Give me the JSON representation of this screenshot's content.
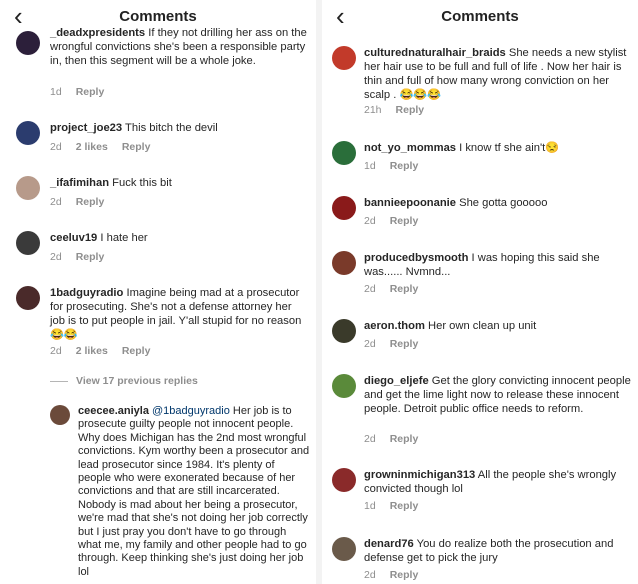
{
  "left": {
    "title": "Comments",
    "comments": [
      {
        "user": "_deadxpresidents",
        "text": "If they not drilling her ass on the wrongful convictions she's been a responsible party in, then this segment will be a whole joke.",
        "time": "1d",
        "reply": "Reply",
        "avatar_color": "#2c1f3a"
      },
      {
        "user": "project_joe23",
        "text": "This bitch the devil",
        "time": "2d",
        "likes": "2 likes",
        "reply": "Reply",
        "avatar_color": "#2b3c6e"
      },
      {
        "user": "_ifafimihan",
        "text": "Fuck this bit",
        "time": "2d",
        "reply": "Reply",
        "avatar_color": "#b79a8a"
      },
      {
        "user": "ceeluv19",
        "text": "I hate her",
        "time": "2d",
        "reply": "Reply",
        "avatar_color": "#3a3a3a"
      },
      {
        "user": "1badguyradio",
        "text": "Imagine being mad at a prosecutor for prosecuting. She's not a defense attorney her job is to put people in jail. Y'all stupid for no reason 😂😂",
        "time": "2d",
        "likes": "2 likes",
        "reply": "Reply",
        "avatar_color": "#4a2a2a"
      }
    ],
    "view_replies": "View 17 previous replies",
    "reply_comment": {
      "user": "ceecee.aniyla",
      "mention": "@1badguyradio",
      "text": "Her job is to prosecute guilty people not innocent people. Why does Michigan has the 2nd most wrongful convictions. Kym worthy been a prosecutor and lead prosecutor since 1984. It's plenty of people who were exonerated because of her convictions and that are still incarcerated. Nobody is mad about her being a prosecutor, we're mad that she's not doing her job correctly but I just pray you don't have to go through what me, my family and other people had to go through. Keep thinking she's just doing her job lol",
      "avatar_color": "#6b4a3a"
    }
  },
  "right": {
    "title": "Comments",
    "comments": [
      {
        "user": "culturednaturalhair_braids",
        "text": "She needs a new stylist her hair use to be full and full of life . Now her hair is thin and full of how many wrong conviction on her scalp . 😂😂😂",
        "time": "21h",
        "reply": "Reply",
        "avatar_color": "#c23a2a"
      },
      {
        "user": "not_yo_mommas",
        "text": "I know tf she ain't😒",
        "time": "1d",
        "reply": "Reply",
        "avatar_color": "#2a6e3a"
      },
      {
        "user": "bannieepoonanie",
        "text": "She gotta gooooo",
        "time": "2d",
        "reply": "Reply",
        "avatar_color": "#8a1a1a"
      },
      {
        "user": "producedbysmooth",
        "text": "I was hoping this said she was...... Nvmnd...",
        "time": "2d",
        "reply": "Reply",
        "avatar_color": "#7a3a2a"
      },
      {
        "user": "aeron.thom",
        "text": "Her own clean up unit",
        "time": "2d",
        "reply": "Reply",
        "avatar_color": "#3a3a2a"
      },
      {
        "user": "diego_eljefe",
        "text": "Get the glory convicting innocent people and get the lime light now to release these innocent people. Detroit public office needs to reform.",
        "time": "2d",
        "reply": "Reply",
        "avatar_color": "#5a8a3a"
      },
      {
        "user": "growninmichigan313",
        "text": "All the people she's wrongly convicted though lol",
        "time": "1d",
        "reply": "Reply",
        "avatar_color": "#8a2a2a"
      },
      {
        "user": "denard76",
        "text": "You do realize both the prosecution and defense get to pick the jury",
        "time": "2d",
        "reply": "Reply",
        "avatar_color": "#6a5a4a"
      }
    ]
  }
}
